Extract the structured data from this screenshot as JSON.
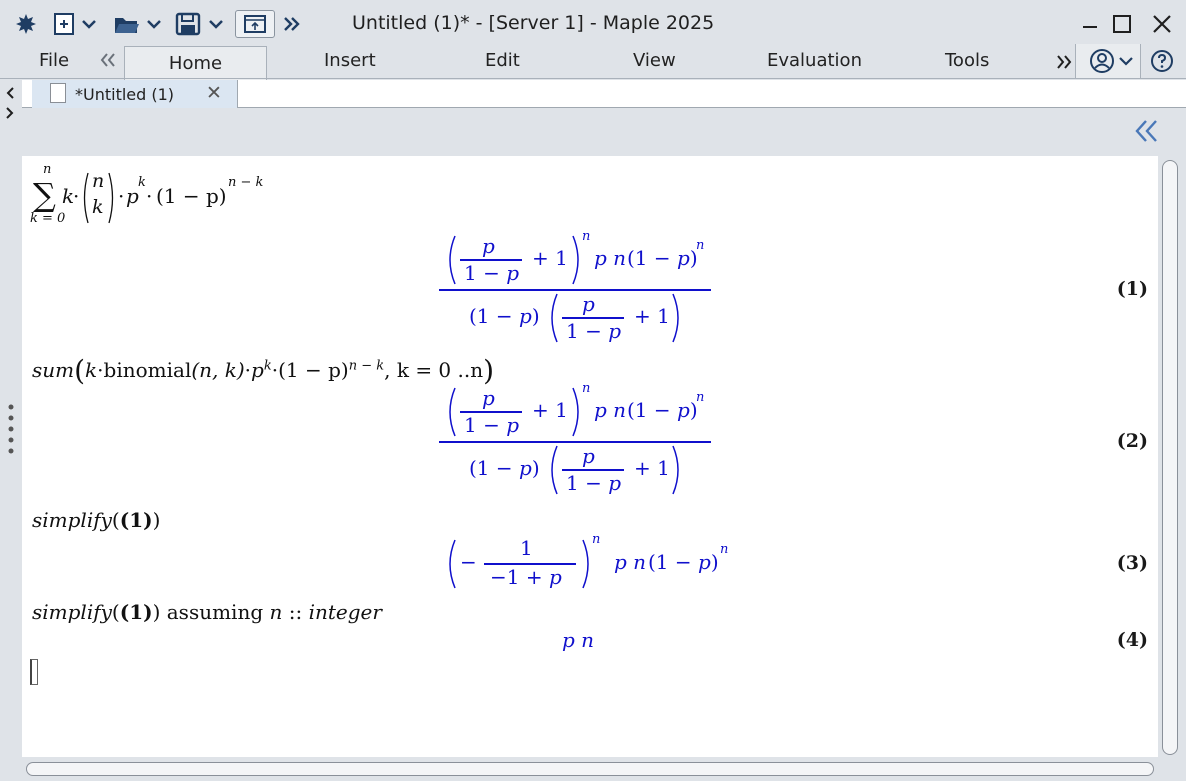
{
  "window": {
    "title": "Untitled (1)* - [Server 1] - Maple 2025"
  },
  "ribbon": {
    "tabs": [
      "File",
      "Home",
      "Insert",
      "Edit",
      "View",
      "Evaluation",
      "Tools"
    ],
    "active_tab": "Home"
  },
  "document_tab": {
    "label": "*Untitled (1)",
    "close_glyph": "✕"
  },
  "worksheet": {
    "statements": [
      {
        "input": "sum_k=0^n k·binomial(n,k)·p^k·(1−p)^(n−k)",
        "output": "(p/(1−p)+1)^n p n (1−p)^n / ((1−p)(p/(1−p)+1))",
        "label": "(1)"
      },
      {
        "input": "sum(k·binomial(n, k)·p^k·(1 − p)^(n − k), k = 0 ..n)",
        "output": "(p/(1−p)+1)^n p n (1−p)^n / ((1−p)(p/(1−p)+1))",
        "label": "(2)"
      },
      {
        "input": "simplify((1))",
        "output": "(−1/(−1+p))^n p n (1−p)^n",
        "label": "(3)"
      },
      {
        "input": "simplify((1)) assuming n :: integer",
        "output": "p n",
        "label": "(4)"
      }
    ]
  },
  "math_text": {
    "sum_sym": "∑",
    "n": "n",
    "k": "k",
    "p": "p",
    "k0": "k = 0",
    "dot": "·",
    "one_minus_p": "(1 − p)",
    "one_minus_p_bare": "1 − p",
    "n_minus_k": "n − k",
    "plus1": "+ 1",
    "one": "1",
    "neg1plusp": "−1 + p",
    "minus": "−",
    "pn": "p n",
    "sum_word": "sum",
    "binomial": "binomial",
    "binom_args": "(n, k)",
    "range": ", k = 0 ..n",
    "simplify": "simplify",
    "ref1": "(1)",
    "assuming": "assuming",
    "n_integer": "n :: integer",
    "colons": "::",
    "integer": "integer"
  },
  "colors": {
    "output_blue": "#1010cc",
    "input_black": "#111111",
    "window_bg": "#dfe3e8",
    "doc_tab_bg": "#dbe6f2"
  },
  "icons": [
    "maple-leaf-icon",
    "new-document-icon",
    "open-folder-icon",
    "save-icon",
    "export-icon",
    "overflow-chevron-icon",
    "minimize-icon",
    "maximize-icon",
    "close-icon",
    "collapse-ribbon-icon",
    "account-icon",
    "help-icon",
    "collapse-panel-icon",
    "scroll-left-icon",
    "scroll-right-icon"
  ]
}
